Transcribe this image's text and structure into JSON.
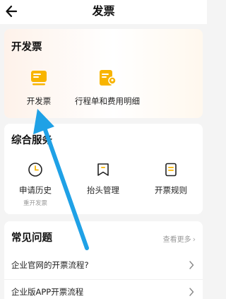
{
  "header": {
    "title": "发票"
  },
  "invoice_section": {
    "title": "开发票",
    "items": [
      {
        "label": "开发票",
        "icon": "invoice-stack-icon"
      },
      {
        "label": "行程单和费用明细",
        "icon": "itinerary-location-icon"
      }
    ]
  },
  "services_section": {
    "title": "综合服务",
    "items": [
      {
        "label": "申请历史",
        "sublabel": "重开发票",
        "icon": "clock-icon"
      },
      {
        "label": "抬头管理",
        "icon": "bookmark-icon"
      },
      {
        "label": "开票规则",
        "icon": "document-list-icon"
      }
    ]
  },
  "faq_section": {
    "title": "常见问题",
    "more_label": "查看更多",
    "items": [
      {
        "question": "企业官网的开票流程?"
      },
      {
        "question": "企业版APP开票流程"
      }
    ]
  },
  "colors": {
    "accent": "#f8b400",
    "annotation_arrow": "#1fa1e6"
  }
}
